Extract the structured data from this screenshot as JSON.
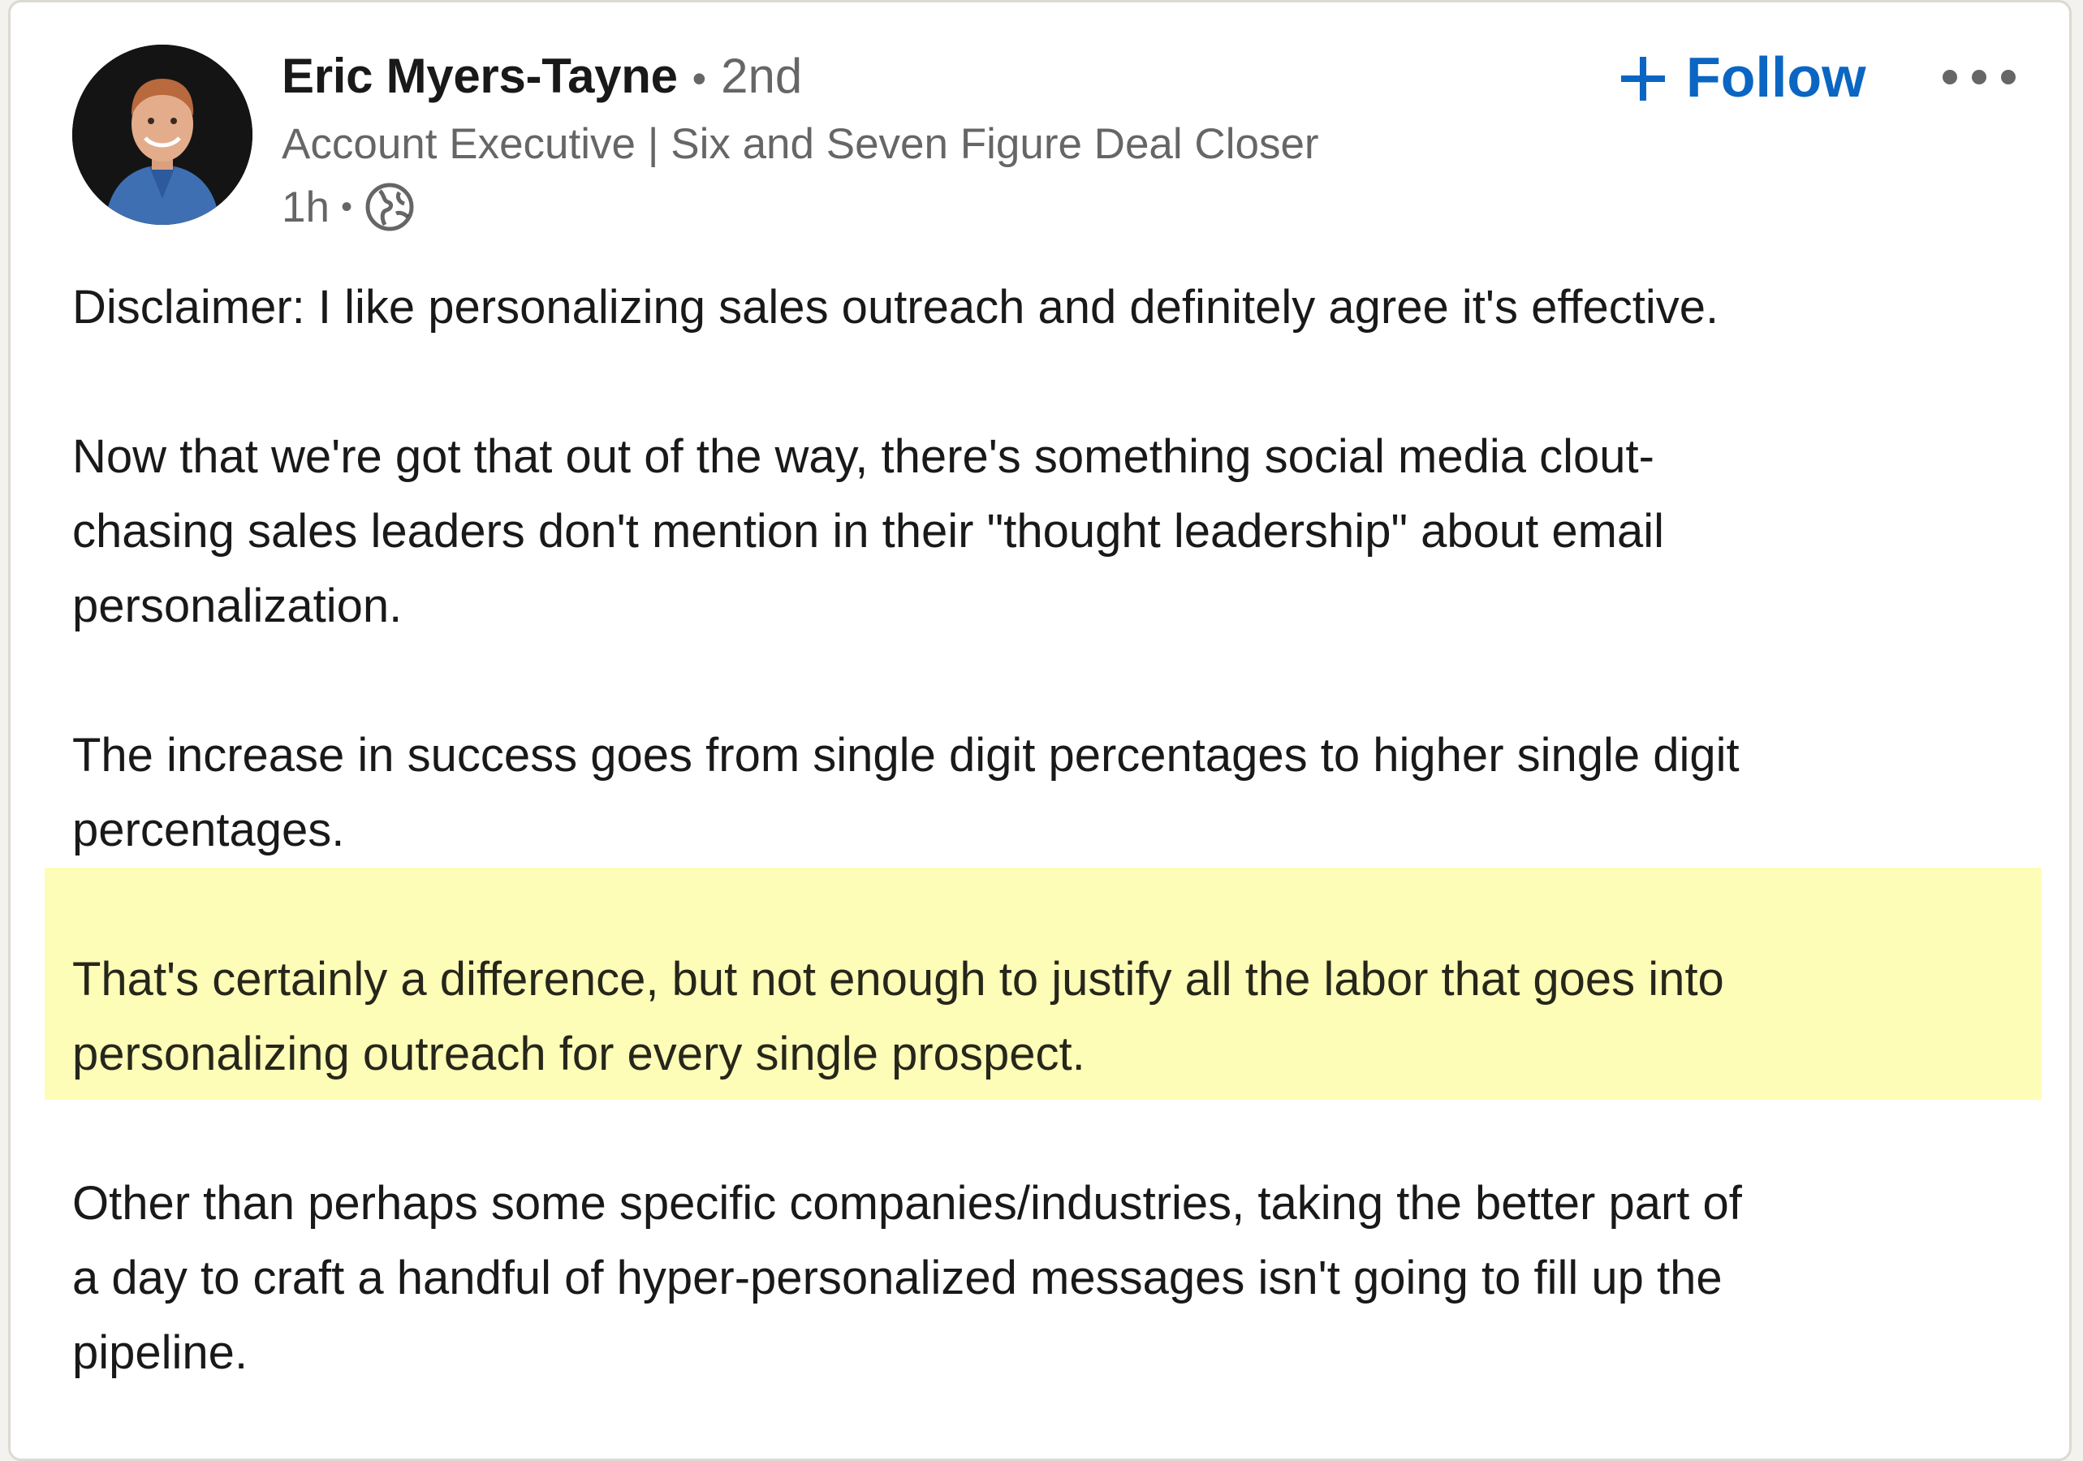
{
  "author": {
    "name": "Eric Myers-Tayne",
    "degree": "2nd",
    "headline": "Account Executive | Six and Seven Figure Deal Closer",
    "time": "1h",
    "visibility_icon": "globe-icon",
    "avatar_icon": "profile-photo"
  },
  "actions": {
    "follow_label": "Follow",
    "follow_icon": "plus-icon",
    "more_icon": "ellipsis-icon"
  },
  "post": {
    "paragraphs": [
      {
        "lines": [
          "Disclaimer: I like personalizing sales outreach and definitely agree it's effective."
        ]
      },
      {
        "lines": [
          "Now that we're got that out of the way, there's something social media clout-",
          "chasing sales leaders don't mention in their \"thought leadership\" about email",
          "personalization."
        ]
      },
      {
        "lines": [
          "The increase in success goes from single digit percentages to higher single digit",
          "percentages."
        ]
      },
      {
        "lines": [
          "That's certainly a difference, but not enough to justify all the labor that goes into",
          "personalizing outreach for every single prospect."
        ],
        "highlighted": true
      },
      {
        "lines": [
          "Other than perhaps some specific companies/industries, taking the better part of",
          "a day to craft a handful of hyper-personalized messages isn't going to fill up the",
          "pipeline."
        ]
      }
    ]
  },
  "colors": {
    "accent": "#0a66c2",
    "highlight": "#fefdb7",
    "card_background": "#ffffff",
    "page_background": "#f4f2ee"
  }
}
